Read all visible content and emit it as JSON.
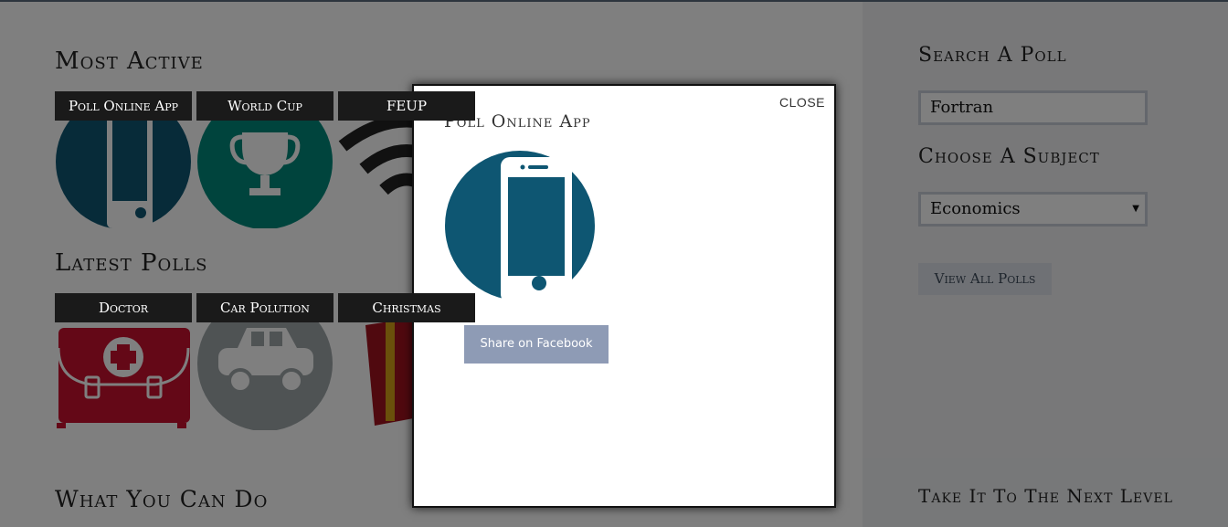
{
  "main": {
    "most_active": {
      "title": "Most Active",
      "tiles": [
        {
          "label": "Poll Online App"
        },
        {
          "label": "World Cup"
        },
        {
          "label": "FEUP"
        }
      ]
    },
    "latest_polls": {
      "title": "Latest Polls",
      "tiles": [
        {
          "label": "Doctor"
        },
        {
          "label": "Car Polution"
        },
        {
          "label": "Christmas"
        }
      ]
    }
  },
  "sidebar": {
    "search": {
      "title": "Search A Poll",
      "value": "Fortran"
    },
    "subject": {
      "title": "Choose A Subject",
      "selected": "Economics"
    },
    "view_all_label": "View All Polls"
  },
  "bottom": {
    "what_you_can_do": "What You Can Do",
    "next_level": "Take It To The Next Level"
  },
  "modal": {
    "close_label": "CLOSE",
    "title": "Poll Online App",
    "image_icon": "phone-icon",
    "share_label": "Share on Facebook"
  },
  "colors": {
    "teal_blue": "#0e5672",
    "teal_green": "#00897b",
    "doctor_red": "#c8102e",
    "car_gray": "#9ea6a9",
    "share_button": "#8e9bb5"
  }
}
